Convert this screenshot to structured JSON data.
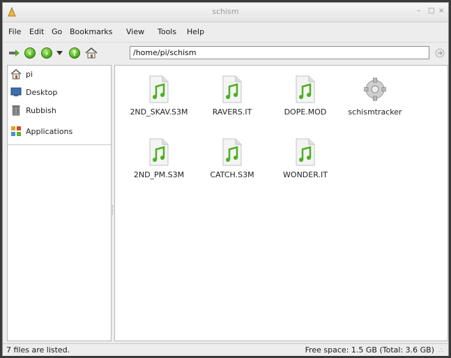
{
  "window": {
    "title": "schism",
    "minimize": "–",
    "maximize": "□",
    "close": "×"
  },
  "menu": [
    "File",
    "Edit",
    "Go",
    "Bookmarks",
    "View",
    "Tools",
    "Help"
  ],
  "toolbar": {
    "path": "/home/pi/schism"
  },
  "sidebar": {
    "items": [
      {
        "label": "pi",
        "icon": "home-icon"
      },
      {
        "label": "Desktop",
        "icon": "desktop-icon"
      },
      {
        "label": "Rubbish",
        "icon": "trash-icon"
      },
      {
        "label": "Applications",
        "icon": "applications-icon"
      }
    ]
  },
  "files": [
    {
      "name": "2ND_SKAV.S3M",
      "icon": "audio-file-icon"
    },
    {
      "name": "RAVERS.IT",
      "icon": "audio-file-icon"
    },
    {
      "name": "DOPE.MOD",
      "icon": "audio-file-icon"
    },
    {
      "name": "schismtracker",
      "icon": "executable-gear-icon"
    },
    {
      "name": "2ND_PM.S3M",
      "icon": "audio-file-icon"
    },
    {
      "name": "CATCH.S3M",
      "icon": "audio-file-icon"
    },
    {
      "name": "WONDER.IT",
      "icon": "audio-file-icon"
    }
  ],
  "status": {
    "left": "7 files are listed.",
    "right": "Free space: 1.5 GB (Total: 3.6 GB)"
  },
  "colors": {
    "accent_green": "#4caf1f",
    "window_bg": "#ededed"
  }
}
